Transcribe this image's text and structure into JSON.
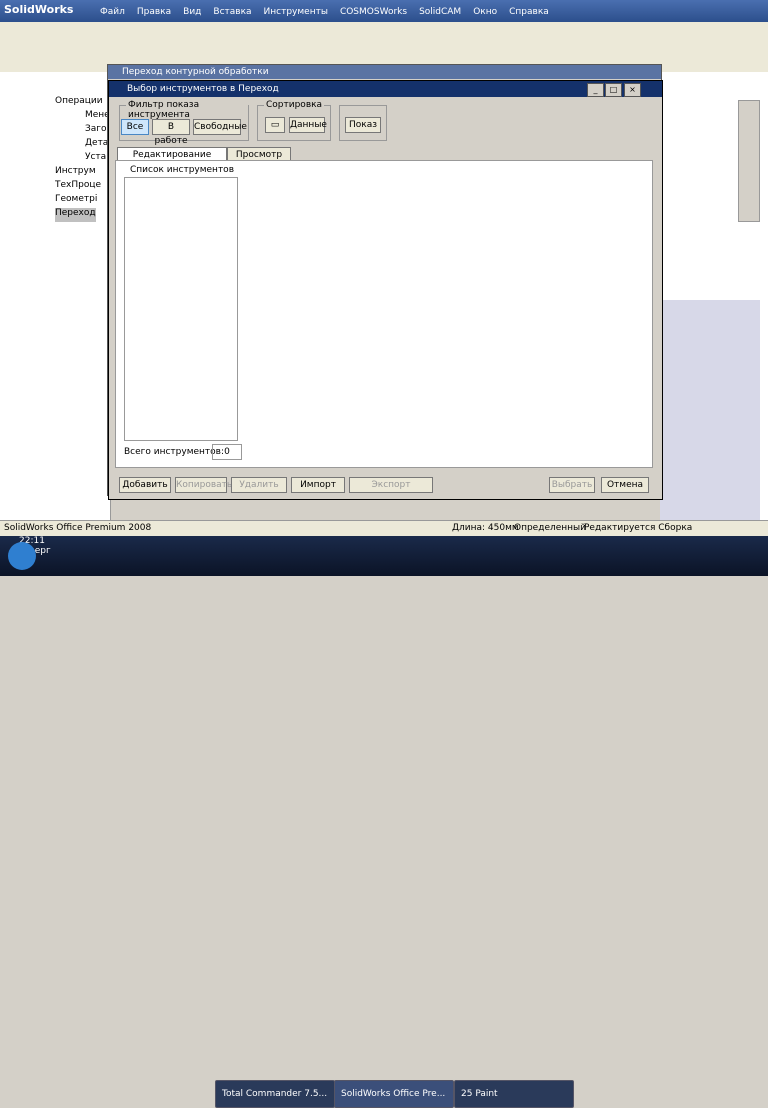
{
  "app": {
    "name": "SolidWorks"
  },
  "menu": [
    "Файл",
    "Правка",
    "Вид",
    "Вставка",
    "Инструменты",
    "COSMOSWorks",
    "SolidCAM",
    "Окно",
    "Справка"
  ],
  "tree": {
    "items": [
      {
        "label": "Операции"
      },
      {
        "label": "Мене"
      },
      {
        "label": "Заго"
      },
      {
        "label": "Дета"
      },
      {
        "label": "Уста"
      },
      {
        "label": "Инструм"
      },
      {
        "label": "ТехПроце"
      },
      {
        "label": "Геометрі"
      },
      {
        "label": "Переход"
      }
    ]
  },
  "dialog_back": {
    "title": "Переход контурной обработки"
  },
  "dialog": {
    "title": "Выбор инструментов в Переход",
    "filter": {
      "title": "Фильтр показа инструмента",
      "all": "Все",
      "in_work": "В работе",
      "free": "Свободные"
    },
    "sort": {
      "title": "Сортировка",
      "data": "Данные"
    },
    "show": {
      "label": "Показ"
    },
    "tabs": {
      "edit": "Редактирование",
      "view": "Просмотр"
    },
    "list": {
      "title": "Список инструментов"
    },
    "total": {
      "label": "Всего инструментов:",
      "value": "0"
    },
    "buttons": {
      "add": "Добавить",
      "copy": "Копировать",
      "delete": "Удалить",
      "import": "Импорт",
      "export": "Экспорт",
      "select": "Выбрать",
      "cancel": "Отмена"
    }
  },
  "statusbar": {
    "left": "SolidWorks Office Premium 2008",
    "length": "Длина: 450мм",
    "defined": "Определенный",
    "editing": "Редактируется Сборка"
  },
  "taskbar": {
    "tasks": [
      "Total Commander 7.5...",
      "SolidWorks Office Pre...",
      "25 Paint"
    ],
    "time": "22:11",
    "day": "четверг"
  }
}
